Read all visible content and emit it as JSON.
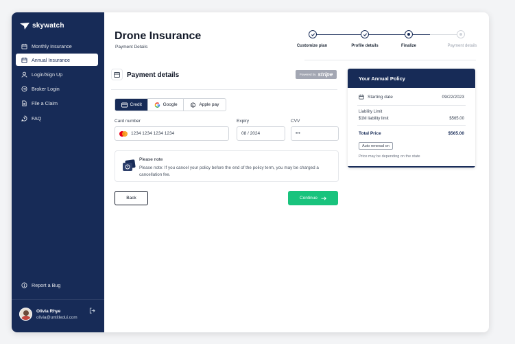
{
  "brand": {
    "name": "skywatch"
  },
  "sidebar": {
    "items": [
      {
        "label": "Monthly Insurance",
        "icon": "calendar-icon",
        "active": false
      },
      {
        "label": "Annual Insurance",
        "icon": "calendar-icon",
        "active": true
      },
      {
        "label": "Login/Sign Up",
        "icon": "user-icon",
        "active": false
      },
      {
        "label": "Broker Login",
        "icon": "login-icon",
        "active": false
      },
      {
        "label": "File a Claim",
        "icon": "document-icon",
        "active": false
      },
      {
        "label": "FAQ",
        "icon": "help-icon",
        "active": false
      }
    ],
    "report_bug": "Report a Bug",
    "user": {
      "name": "Olivia Rhye",
      "email": "olivia@untitledui.com"
    }
  },
  "header": {
    "title": "Drone Insurance",
    "subtitle": "Payment Details"
  },
  "stepper": {
    "steps": [
      {
        "label": "Customize plan",
        "state": "done"
      },
      {
        "label": "Profile details",
        "state": "done"
      },
      {
        "label": "Finalize",
        "state": "current"
      },
      {
        "label": "Payment details",
        "state": "todo"
      }
    ]
  },
  "payment": {
    "title": "Payment details",
    "powered_by": "Powered by",
    "stripe": "stripe",
    "methods": [
      {
        "label": "Credit",
        "icon": "credit-card-icon",
        "active": true
      },
      {
        "label": "Google",
        "icon": "google-icon",
        "active": false
      },
      {
        "label": "Apple pay",
        "icon": "apple-icon",
        "active": false
      }
    ],
    "card_number_label": "Card number",
    "card_number_value": "1234 1234 1234 1234",
    "expiry_label": "Expiry",
    "expiry_value": "08 / 2024",
    "cvv_label": "CVV",
    "cvv_value": "•••",
    "note_title": "Please note",
    "note_text": "Please note: If you cancel your policy before the end of the policy term, you may be charged a cancellation fee.",
    "back_label": "Back",
    "continue_label": "Continue"
  },
  "policy": {
    "title": "Your Annual Policy",
    "start_label": "Starting date",
    "start_value": "09/22/2023",
    "liability_label": "Liability Limit",
    "sm_label": "$1M liability limit",
    "sm_value": "$565.00",
    "total_label": "Total Price",
    "total_value": "$565.00",
    "auto_renew": "Auto renewal on",
    "price_note": "Price may be depending on the state"
  },
  "colors": {
    "navy": "#172b57",
    "green": "#19c37d",
    "stripe_badge": "#a3a7b3"
  }
}
